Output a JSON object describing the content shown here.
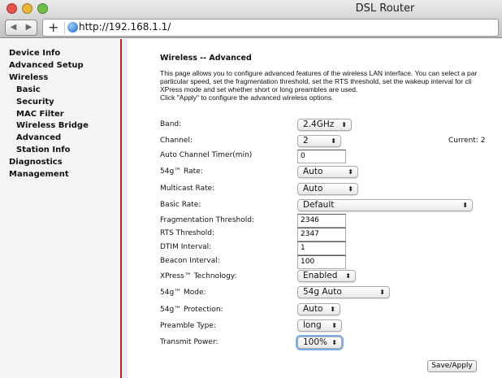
{
  "window": {
    "title": "DSL Router",
    "url": "http://192.168.1.1/"
  },
  "icons": {
    "back": "◀",
    "forward": "▶",
    "add": "+"
  },
  "sidebar": {
    "items": [
      {
        "label": "Device Info",
        "indent": 0
      },
      {
        "label": "Advanced Setup",
        "indent": 0
      },
      {
        "label": "Wireless",
        "indent": 0
      },
      {
        "label": "Basic",
        "indent": 1
      },
      {
        "label": "Security",
        "indent": 1
      },
      {
        "label": "MAC Filter",
        "indent": 1
      },
      {
        "label": "Wireless Bridge",
        "indent": 1
      },
      {
        "label": "Advanced",
        "indent": 1
      },
      {
        "label": "Station Info",
        "indent": 1
      },
      {
        "label": "Diagnostics",
        "indent": 0
      },
      {
        "label": "Management",
        "indent": 0
      }
    ]
  },
  "main": {
    "heading": "Wireless -- Advanced",
    "description": [
      "This page allows you to configure advanced features of the wireless LAN interface. You can select a par",
      "particular speed, set the fragmentation threshold, set the RTS threshold, set the wakeup interval for cli",
      "XPress mode and set whether short or long preambles are used.",
      "Click \"Apply\" to configure the advanced wireless options."
    ],
    "fields": {
      "band": {
        "label": "Band:",
        "value": "2.4GHz"
      },
      "channel": {
        "label": "Channel:",
        "value": "2",
        "current": "Current: 2"
      },
      "auto_channel_timer": {
        "label": "Auto Channel Timer(min)",
        "value": "0"
      },
      "rate": {
        "label": "54g™ Rate:",
        "value": "Auto"
      },
      "multicast_rate": {
        "label": "Multicast Rate:",
        "value": "Auto"
      },
      "basic_rate": {
        "label": "Basic Rate:",
        "value": "Default"
      },
      "frag": {
        "label": "Fragmentation Threshold:",
        "value": "2346"
      },
      "rts": {
        "label": "RTS Threshold:",
        "value": "2347"
      },
      "dtim": {
        "label": "DTIM Interval:",
        "value": "1"
      },
      "beacon": {
        "label": "Beacon Interval:",
        "value": "100"
      },
      "xpress": {
        "label": "XPress™ Technology:",
        "value": "Enabled"
      },
      "mode": {
        "label": "54g™ Mode:",
        "value": "54g Auto"
      },
      "protection": {
        "label": "54g™ Protection:",
        "value": "Auto"
      },
      "preamble": {
        "label": "Preamble Type:",
        "value": "long"
      },
      "power": {
        "label": "Transmit Power:",
        "value": "100%"
      }
    },
    "save_label": "Save/Apply"
  }
}
